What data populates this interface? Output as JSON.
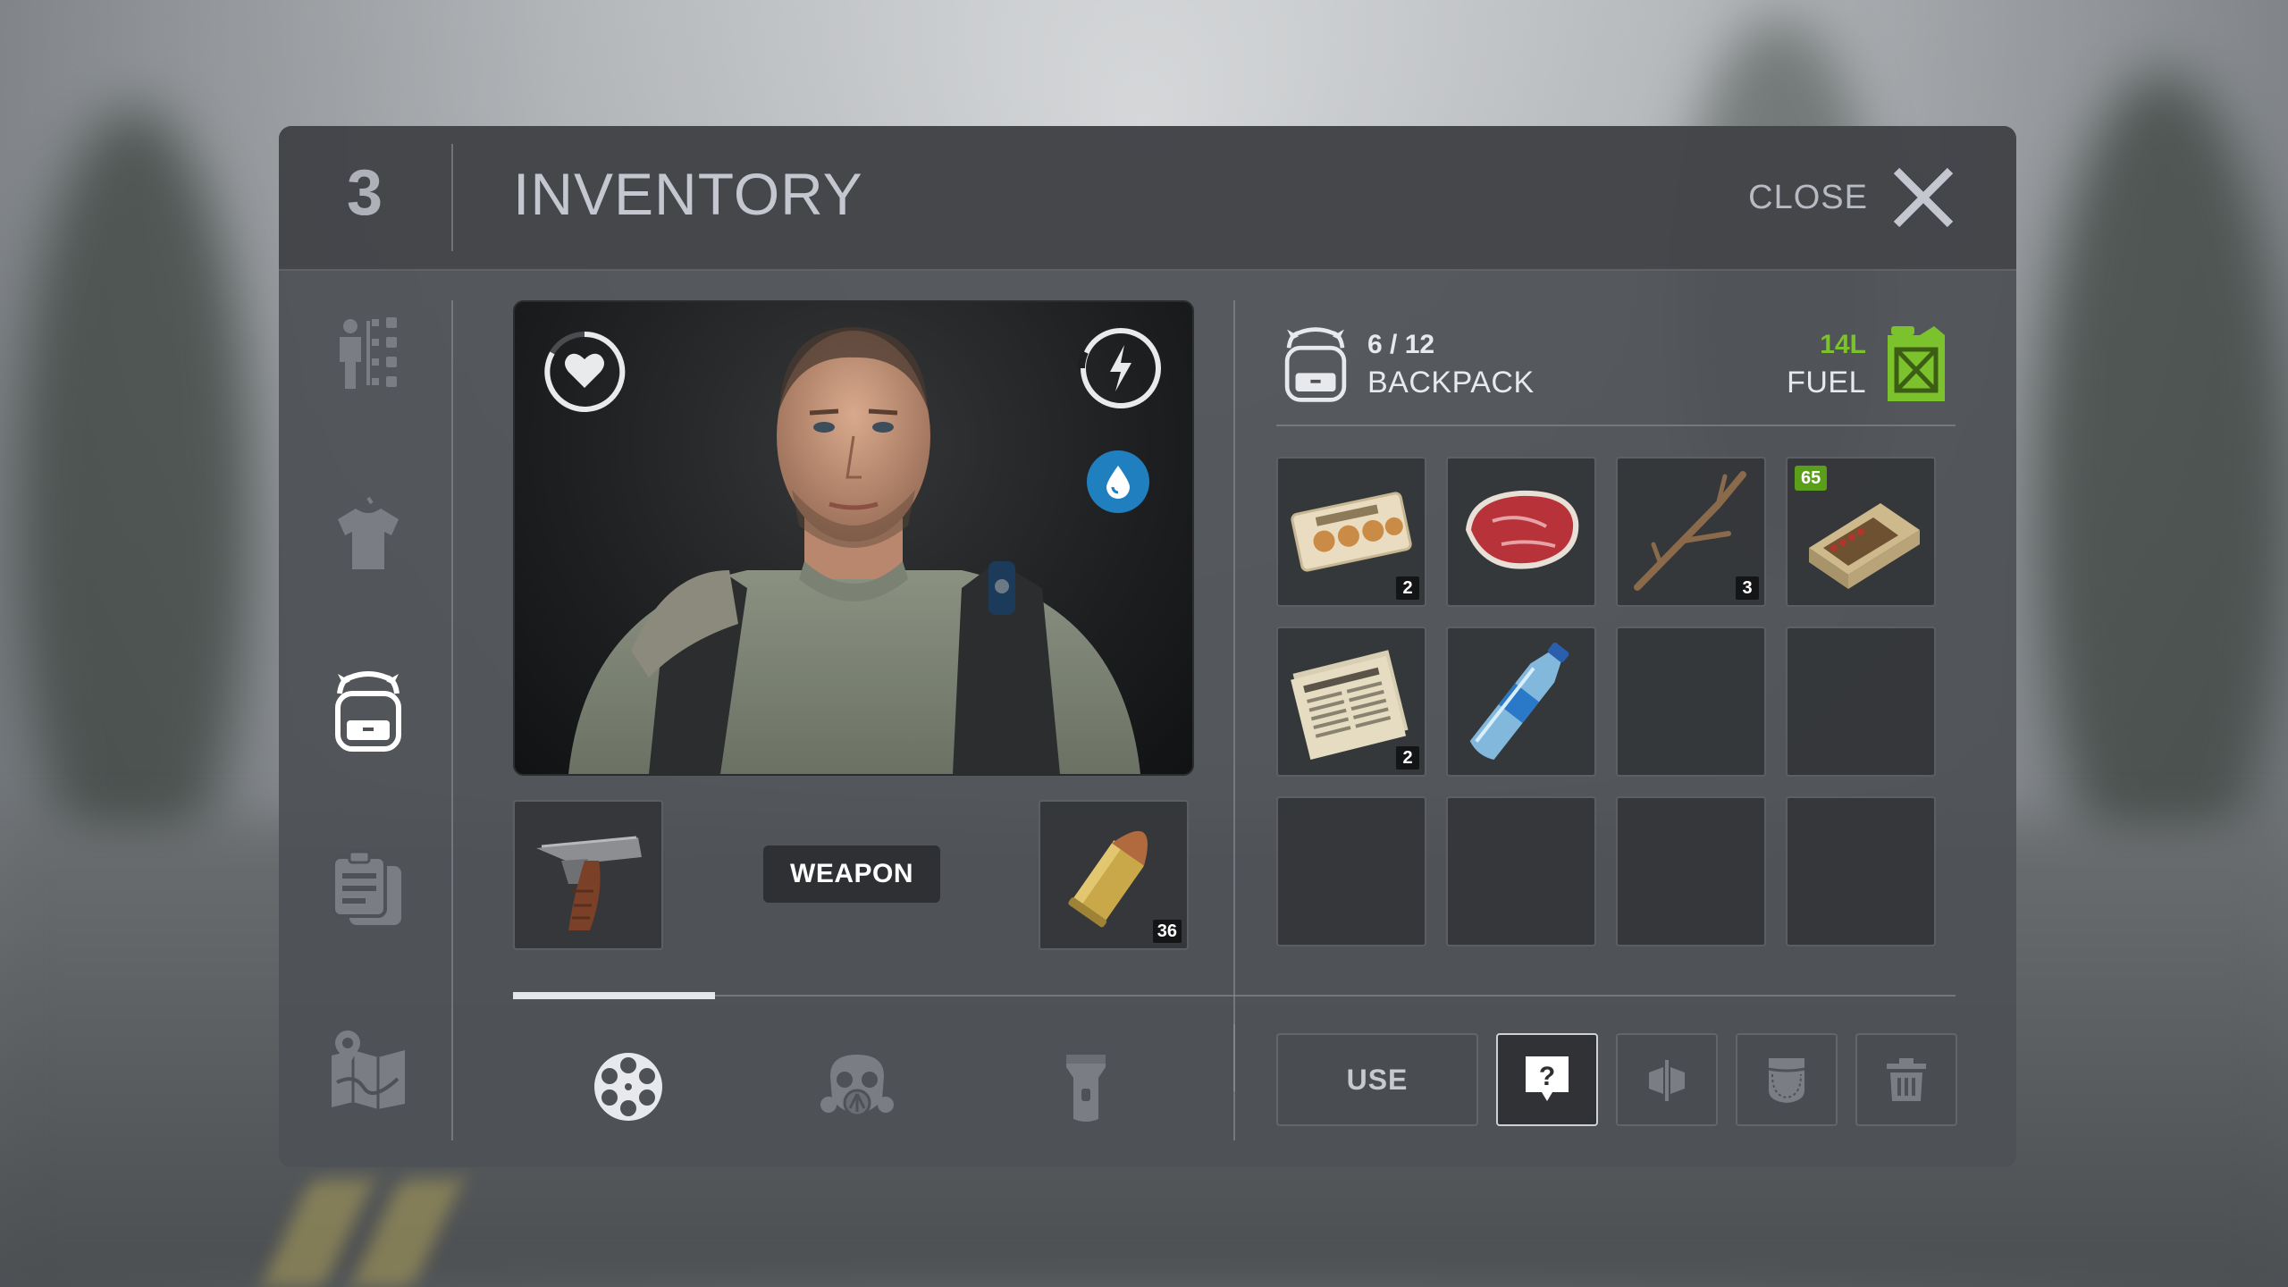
{
  "header": {
    "page_number": "3",
    "title": "INVENTORY",
    "close_label": "CLOSE"
  },
  "sidebar": {
    "items": [
      {
        "icon": "character-stats-icon",
        "active": false
      },
      {
        "icon": "clothing-icon",
        "active": false
      },
      {
        "icon": "backpack-icon",
        "active": true
      },
      {
        "icon": "journal-icon",
        "active": false
      },
      {
        "icon": "map-icon",
        "active": false
      }
    ]
  },
  "character": {
    "stats": [
      {
        "icon": "heart-icon",
        "level": 0.85
      },
      {
        "icon": "energy-icon",
        "level": 0.95
      },
      {
        "icon": "water-drop-icon"
      }
    ]
  },
  "weapon": {
    "label": "WEAPON",
    "slot_item": "pistol",
    "ammo_item": "bullet",
    "ammo_count": "36"
  },
  "backpack": {
    "count": "6 / 12",
    "label": "BACKPACK",
    "fuel_amount": "14L",
    "fuel_label": "FUEL",
    "slots": [
      {
        "item": "crackers",
        "qty": "2"
      },
      {
        "item": "raw steak",
        "qty": ""
      },
      {
        "item": "stick",
        "qty": "3"
      },
      {
        "item": "matches",
        "badge": "65"
      },
      {
        "item": "newspaper",
        "qty": "2"
      },
      {
        "item": "water bottle",
        "qty": ""
      },
      {},
      {},
      {},
      {},
      {},
      {}
    ]
  },
  "bottom_tabs": {
    "progress": 0.14,
    "tabs": [
      {
        "icon": "revolver-cylinder-icon",
        "active": true
      },
      {
        "icon": "gas-mask-icon",
        "active": false
      },
      {
        "icon": "flashlight-icon",
        "active": false
      }
    ]
  },
  "actions": {
    "use_label": "USE",
    "buttons": [
      "help-icon",
      "split-icon",
      "pocket-icon",
      "trash-icon"
    ]
  },
  "colors": {
    "accent_green": "#7cc22c",
    "water_blue": "#1f7fbf"
  }
}
